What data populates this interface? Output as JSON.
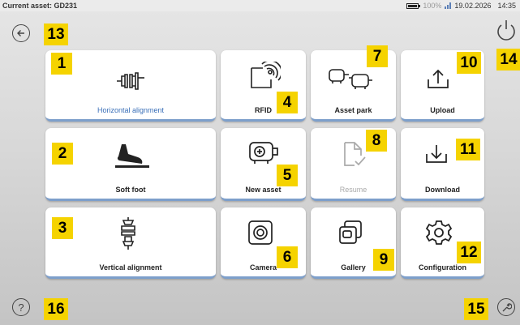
{
  "status": {
    "asset_label": "Current asset: GD231",
    "battery": "100%",
    "date": "19.02.2026",
    "time": "14:35"
  },
  "tiles": [
    {
      "label": "Horizontal alignment",
      "icon": "horizontal-alignment-icon",
      "badge": "1"
    },
    {
      "label": "RFID",
      "icon": "rfid-icon",
      "badge": "4"
    },
    {
      "label": "Asset park",
      "icon": "asset-park-icon",
      "badge": "7"
    },
    {
      "label": "Upload",
      "icon": "upload-icon",
      "badge": "10"
    },
    {
      "label": "Soft foot",
      "icon": "soft-foot-icon",
      "badge": "2"
    },
    {
      "label": "New asset",
      "icon": "new-asset-icon",
      "badge": "5"
    },
    {
      "label": "Resume",
      "icon": "resume-icon",
      "badge": "8"
    },
    {
      "label": "Download",
      "icon": "download-icon",
      "badge": "11"
    },
    {
      "label": "Vertical alignment",
      "icon": "vertical-alignment-icon",
      "badge": "3"
    },
    {
      "label": "Camera",
      "icon": "camera-icon",
      "badge": "6"
    },
    {
      "label": "Gallery",
      "icon": "gallery-icon",
      "badge": "9"
    },
    {
      "label": "Configuration",
      "icon": "gear-icon",
      "badge": "12"
    }
  ],
  "corners": {
    "back": {
      "icon": "back-arrow-icon",
      "badge": "13"
    },
    "power": {
      "icon": "power-icon",
      "badge": "14"
    },
    "tools": {
      "icon": "wrench-icon",
      "badge": "15"
    },
    "help": {
      "icon": "help-icon",
      "badge": "16",
      "glyph": "?"
    }
  },
  "colors": {
    "badge": "#f5d300",
    "tile_underline": "#7d9fcb",
    "accent_label": "#3a6fb8",
    "disabled": "#aaaaaa"
  }
}
